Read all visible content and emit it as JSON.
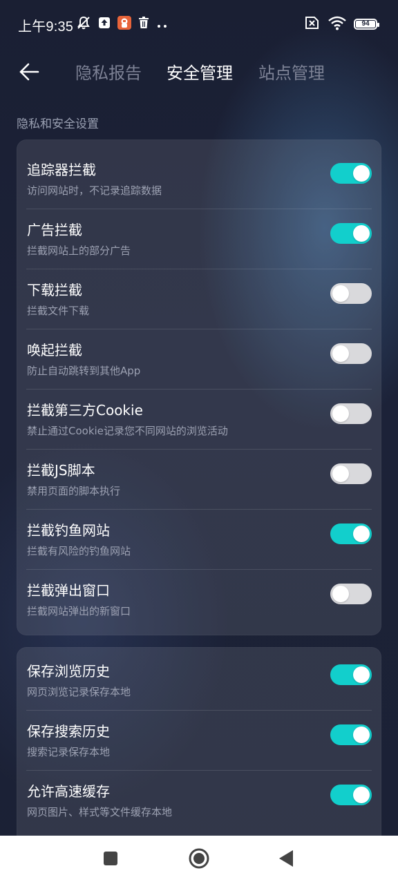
{
  "status_bar": {
    "time": "上午9:35",
    "battery": "94",
    "left_icons": [
      "notification-muted-icon",
      "upload-icon",
      "app-notification-icon",
      "trash-icon",
      "more-dots-icon"
    ],
    "right_icons": [
      "sim-off-icon",
      "wifi-icon",
      "battery-icon"
    ]
  },
  "header": {
    "tabs": [
      {
        "label": "隐私报告",
        "active": false
      },
      {
        "label": "安全管理",
        "active": true
      },
      {
        "label": "站点管理",
        "active": false
      }
    ]
  },
  "section_title": "隐私和安全设置",
  "card1": {
    "items": [
      {
        "title": "追踪器拦截",
        "desc": "访问网站时，不记录追踪数据",
        "on": true
      },
      {
        "title": "广告拦截",
        "desc": "拦截网站上的部分广告",
        "on": true
      },
      {
        "title": "下载拦截",
        "desc": "拦截文件下载",
        "on": false
      },
      {
        "title": "唤起拦截",
        "desc": "防止自动跳转到其他App",
        "on": false
      },
      {
        "title": "拦截第三方Cookie",
        "desc": "禁止通过Cookie记录您不同网站的浏览活动",
        "on": false
      },
      {
        "title": "拦截JS脚本",
        "desc": "禁用页面的脚本执行",
        "on": false
      },
      {
        "title": "拦截钓鱼网站",
        "desc": "拦截有风险的钓鱼网站",
        "on": true
      },
      {
        "title": "拦截弹出窗口",
        "desc": "拦截网站弹出的新窗口",
        "on": false
      }
    ]
  },
  "card2": {
    "items": [
      {
        "title": "保存浏览历史",
        "desc": "网页浏览记录保存本地",
        "on": true
      },
      {
        "title": "保存搜索历史",
        "desc": "搜索记录保存本地",
        "on": true
      },
      {
        "title": "允许高速缓存",
        "desc": "网页图片、样式等文件缓存本地",
        "on": true
      }
    ]
  },
  "colors": {
    "toggle_on": "#12cfcc",
    "toggle_off": "#d9d9dc",
    "background": "#1b2135"
  },
  "nav_bar": {
    "icons": [
      "recent-apps-icon",
      "home-icon",
      "back-nav-icon"
    ]
  }
}
